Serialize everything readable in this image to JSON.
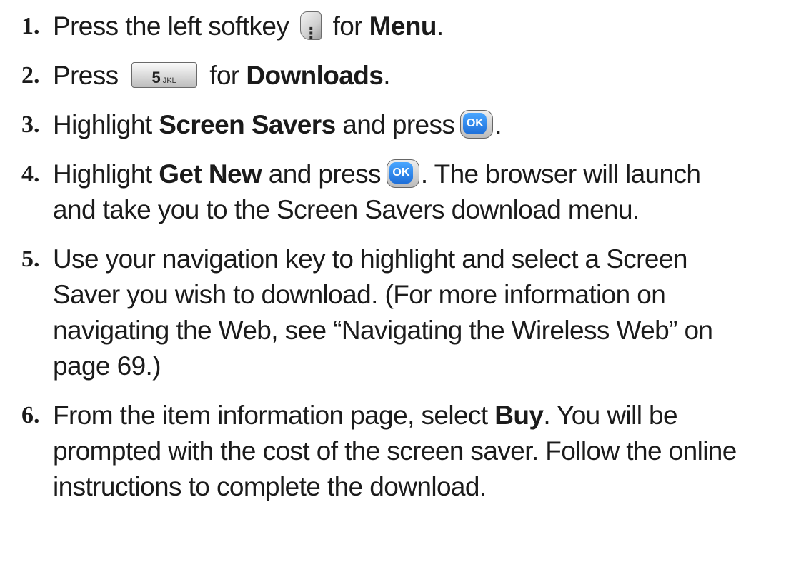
{
  "steps": [
    {
      "number": "1.",
      "text_a": "Press the left softkey",
      "text_b": "for ",
      "bold": "Menu",
      "text_c": "."
    },
    {
      "number": "2.",
      "text_a": "Press",
      "key_digit": "5",
      "key_letters": "JKL",
      "text_b": "for ",
      "bold": "Downloads",
      "text_c": "."
    },
    {
      "number": "3.",
      "text_a": "Highlight ",
      "bold": "Screen Savers",
      "text_b": " and press",
      "text_c": "."
    },
    {
      "number": "4.",
      "text_a": "Highlight ",
      "bold": "Get New",
      "text_b": " and press",
      "text_c": ". The browser will launch",
      "line2": "and take you to the Screen Savers download menu."
    },
    {
      "number": "5.",
      "lines": [
        "Use your navigation key to highlight and select a Screen",
        "Saver you wish to download. (For more information on",
        "navigating the Web, see “Navigating the Wireless Web” on",
        "page 69.)"
      ]
    },
    {
      "number": "6.",
      "text_a": "From the item information page, select ",
      "bold": "Buy",
      "text_b": ". You will be",
      "lines": [
        "prompted with the cost of the screen saver. Follow the online",
        "instructions to complete the download."
      ]
    }
  ],
  "keys": {
    "ok_label": "OK"
  },
  "icons": {
    "softkey": "left-softkey-icon",
    "numkey": "five-key-icon",
    "ok": "ok-key-icon"
  }
}
